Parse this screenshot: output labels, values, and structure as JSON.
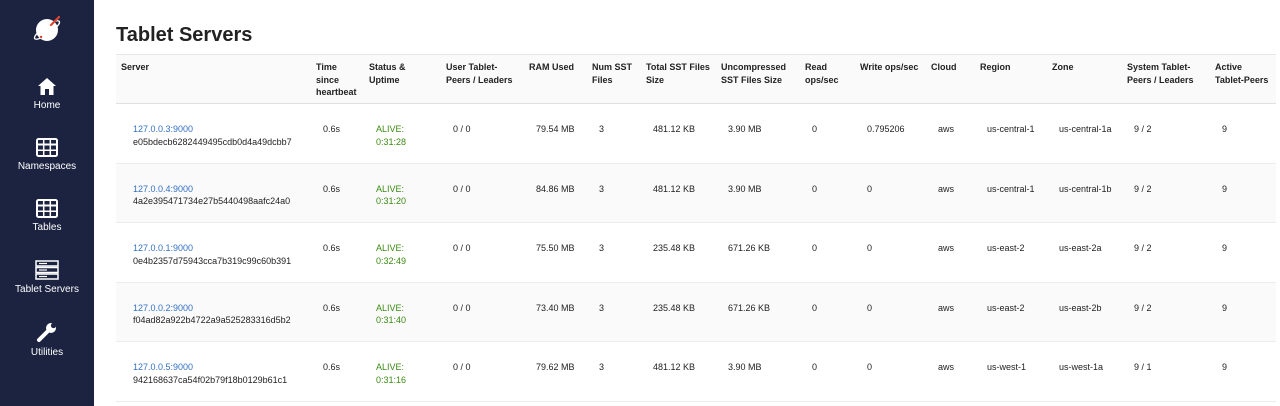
{
  "sidebar": {
    "items": [
      {
        "label": "Home",
        "icon": "home-icon"
      },
      {
        "label": "Namespaces",
        "icon": "grid-icon"
      },
      {
        "label": "Tables",
        "icon": "grid-icon"
      },
      {
        "label": "Tablet Servers",
        "icon": "server-stack-icon"
      },
      {
        "label": "Utilities",
        "icon": "wrench-icon"
      }
    ]
  },
  "page": {
    "title": "Tablet Servers"
  },
  "table": {
    "headers": [
      "Server",
      "Time since heartbeat",
      "Status & Uptime",
      "User Tablet-Peers / Leaders",
      "RAM Used",
      "Num SST Files",
      "Total SST Files Size",
      "Uncompressed SST Files Size",
      "Read ops/sec",
      "Write ops/sec",
      "Cloud",
      "Region",
      "Zone",
      "System Tablet-Peers / Leaders",
      "Active Tablet-Peers"
    ],
    "rows": [
      {
        "server": "127.0.0.3:9000",
        "uuid": "e05bdecb6282449495cdb0d4a49dcbb7",
        "heartbeat": "0.6s",
        "status": "ALIVE:",
        "uptime": "0:31:28",
        "user_peers": "0 / 0",
        "ram": "79.54 MB",
        "sst_files": "3",
        "sst_size": "481.12 KB",
        "uncompressed": "3.90 MB",
        "read_ops": "0",
        "write_ops": "0.795206",
        "cloud": "aws",
        "region": "us-central-1",
        "zone": "us-central-1a",
        "system_peers": "9 / 2",
        "active_peers": "9"
      },
      {
        "server": "127.0.0.4:9000",
        "uuid": "4a2e395471734e27b5440498aafc24a0",
        "heartbeat": "0.6s",
        "status": "ALIVE:",
        "uptime": "0:31:20",
        "user_peers": "0 / 0",
        "ram": "84.86 MB",
        "sst_files": "3",
        "sst_size": "481.12 KB",
        "uncompressed": "3.90 MB",
        "read_ops": "0",
        "write_ops": "0",
        "cloud": "aws",
        "region": "us-central-1",
        "zone": "us-central-1b",
        "system_peers": "9 / 2",
        "active_peers": "9"
      },
      {
        "server": "127.0.0.1:9000",
        "uuid": "0e4b2357d75943cca7b319c99c60b391",
        "heartbeat": "0.6s",
        "status": "ALIVE:",
        "uptime": "0:32:49",
        "user_peers": "0 / 0",
        "ram": "75.50 MB",
        "sst_files": "3",
        "sst_size": "235.48 KB",
        "uncompressed": "671.26 KB",
        "read_ops": "0",
        "write_ops": "0",
        "cloud": "aws",
        "region": "us-east-2",
        "zone": "us-east-2a",
        "system_peers": "9 / 2",
        "active_peers": "9"
      },
      {
        "server": "127.0.0.2:9000",
        "uuid": "f04ad82a922b4722a9a525283316d5b2",
        "heartbeat": "0.6s",
        "status": "ALIVE:",
        "uptime": "0:31:40",
        "user_peers": "0 / 0",
        "ram": "73.40 MB",
        "sst_files": "3",
        "sst_size": "235.48 KB",
        "uncompressed": "671.26 KB",
        "read_ops": "0",
        "write_ops": "0",
        "cloud": "aws",
        "region": "us-east-2",
        "zone": "us-east-2b",
        "system_peers": "9 / 2",
        "active_peers": "9"
      },
      {
        "server": "127.0.0.5:9000",
        "uuid": "942168637ca54f02b79f18b0129b61c1",
        "heartbeat": "0.6s",
        "status": "ALIVE:",
        "uptime": "0:31:16",
        "user_peers": "0 / 0",
        "ram": "79.62 MB",
        "sst_files": "3",
        "sst_size": "481.12 KB",
        "uncompressed": "3.90 MB",
        "read_ops": "0",
        "write_ops": "0",
        "cloud": "aws",
        "region": "us-west-1",
        "zone": "us-west-1a",
        "system_peers": "9 / 1",
        "active_peers": "9"
      }
    ]
  },
  "colors": {
    "sidebar_bg": "#1c2340",
    "link": "#3371c4",
    "alive": "#3b8a13",
    "logo_accent": "#e0442e"
  }
}
